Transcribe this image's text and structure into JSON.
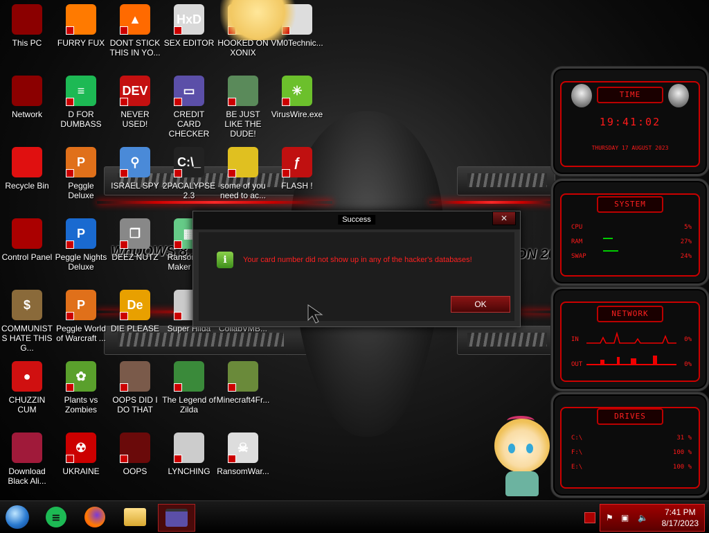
{
  "desktop_icons": [
    {
      "label": "This PC",
      "glyph": "",
      "color": "#8b0000",
      "icon": "computer-icon"
    },
    {
      "label": "FURRY FUX",
      "glyph": "",
      "color": "#ff7a00",
      "icon": "firefox-icon"
    },
    {
      "label": "DONT STICK THIS IN YO...",
      "glyph": "▲",
      "color": "#ff6a00",
      "icon": "vlc-cone-icon"
    },
    {
      "label": "SEX EDITOR",
      "glyph": "HxD",
      "color": "#d9d9d9",
      "icon": "hex-editor-icon"
    },
    {
      "label": "HOOKED ON XONIX",
      "glyph": "",
      "color": "#f3d18f",
      "icon": "cartoon-icon"
    },
    {
      "label": "VM0Technic...",
      "glyph": "",
      "color": "#ddd",
      "icon": "file-icon"
    },
    {
      "label": "Network",
      "glyph": "",
      "color": "#8b0000",
      "icon": "network-icon"
    },
    {
      "label": "D FOR DUMBASS",
      "glyph": "≡",
      "color": "#1db954",
      "icon": "spotify-icon"
    },
    {
      "label": "NEVER USED!",
      "glyph": "DEV",
      "color": "#c41010",
      "icon": "devcpp-icon"
    },
    {
      "label": "CREDIT CARD CHECKER",
      "glyph": "▭",
      "color": "#5b4fa8",
      "icon": "credit-card-icon"
    },
    {
      "label": "BE JUST LIKE THE DUDE!",
      "glyph": "",
      "color": "#5a8a5a",
      "icon": "elf-icon"
    },
    {
      "label": "VirusWire.exe",
      "glyph": "✳",
      "color": "#6cc02c",
      "icon": "limewire-icon"
    },
    {
      "label": "Recycle Bin",
      "glyph": "",
      "color": "#e01010",
      "icon": "recycle-bin-icon"
    },
    {
      "label": "Peggle Deluxe",
      "glyph": "P",
      "color": "#e0701a",
      "icon": "peggle-icon"
    },
    {
      "label": "ISRAEL SPY",
      "glyph": "⚲",
      "color": "#4a8ad8",
      "icon": "spy-icon"
    },
    {
      "label": "2PACALYPSE 2.3",
      "glyph": "C:\\_",
      "color": "#222",
      "icon": "terminal-icon"
    },
    {
      "label": "some of you need to ac...",
      "glyph": "",
      "color": "#e0c020",
      "icon": "dog-icon"
    },
    {
      "label": "FLASH !",
      "glyph": "ƒ",
      "color": "#c01010",
      "icon": "flash-icon"
    },
    {
      "label": "Control Panel",
      "glyph": "",
      "color": "#a00",
      "icon": "control-panel-icon"
    },
    {
      "label": "Peggle Nights Deluxe",
      "glyph": "P",
      "color": "#1a6ad0",
      "icon": "peggle-icon"
    },
    {
      "label": "DEEZ NUTZ",
      "glyph": "❐",
      "color": "#888",
      "icon": "windows-icon"
    },
    {
      "label": "Ransomw... Maker Bu...",
      "glyph": "▦",
      "color": "#6c8",
      "icon": "ransomware-icon"
    },
    {
      "label": "",
      "glyph": "",
      "color": "transparent",
      "icon": "hidden-icon"
    },
    {
      "label": "",
      "glyph": "",
      "color": "transparent",
      "icon": "hidden-icon"
    },
    {
      "label": "COMMUNISTS HATE THIS G...",
      "glyph": "$",
      "color": "#8a6a3a",
      "icon": "money-bag-icon"
    },
    {
      "label": "Peggle World of Warcraft ...",
      "glyph": "P",
      "color": "#e0701a",
      "icon": "peggle-icon"
    },
    {
      "label": "DIE PLEASE",
      "glyph": "De",
      "color": "#e8a000",
      "icon": "delphi-icon"
    },
    {
      "label": "Super Hilda",
      "glyph": "",
      "color": "#ccc",
      "icon": "game-icon"
    },
    {
      "label": "CollabVMB...",
      "glyph": "",
      "color": "transparent",
      "icon": "file-icon"
    },
    {
      "label": "",
      "glyph": "",
      "color": "transparent",
      "icon": "hidden-icon"
    },
    {
      "label": "CHUZZIN CUM",
      "glyph": "●",
      "color": "#d01010",
      "icon": "chuzzle-icon"
    },
    {
      "label": "Plants vs Zombies",
      "glyph": "✿",
      "color": "#5aa02c",
      "icon": "pvz-icon"
    },
    {
      "label": "OOPS DID I DO THAT",
      "glyph": "",
      "color": "#7a5a4a",
      "icon": "portrait-icon"
    },
    {
      "label": "The Legend of Zilda",
      "glyph": "",
      "color": "#3a8a3a",
      "icon": "zelda-icon"
    },
    {
      "label": "Minecraft4Fr...",
      "glyph": "",
      "color": "#6a8a3a",
      "icon": "minecraft-icon"
    },
    {
      "label": "",
      "glyph": "",
      "color": "transparent",
      "icon": "hidden-icon"
    },
    {
      "label": "Download Black Ali...",
      "glyph": "",
      "color": "#a01a3a",
      "icon": "alien-icon"
    },
    {
      "label": "UKRAINE",
      "glyph": "☢",
      "color": "#c00",
      "icon": "radiation-icon"
    },
    {
      "label": "OOPS",
      "glyph": "",
      "color": "#6a0a0a",
      "icon": "folder-icon"
    },
    {
      "label": "LYNCHING",
      "glyph": "",
      "color": "#ccc",
      "icon": "gear-icon"
    },
    {
      "label": "RansomWar...",
      "glyph": "☠",
      "color": "#ddd",
      "icon": "skull-icon"
    },
    {
      "label": "",
      "glyph": "",
      "color": "transparent",
      "icon": "hidden-icon"
    }
  ],
  "wallpaper_text": {
    "left": "WnDOWS 8.1",
    "right": "ON 20"
  },
  "widgets": {
    "time": {
      "title": "TIME",
      "clock": "19:41:02",
      "date": "THURSDAY 17 AUGUST 2023"
    },
    "system": {
      "title": "SYSTEM",
      "rows": [
        {
          "label": "CPU",
          "value": "5%"
        },
        {
          "label": "RAM",
          "value": "27%"
        },
        {
          "label": "SWAP",
          "value": "24%"
        }
      ]
    },
    "network": {
      "title": "NETWORK",
      "rows": [
        {
          "label": "IN",
          "value": "0%"
        },
        {
          "label": "OUT",
          "value": "0%"
        }
      ]
    },
    "drives": {
      "title": "DRIVES",
      "rows": [
        {
          "label": "C:\\",
          "value": "31 %"
        },
        {
          "label": "F:\\",
          "value": "100 %"
        },
        {
          "label": "E:\\",
          "value": "100 %"
        }
      ]
    }
  },
  "dialog": {
    "title": "Success",
    "message": "Your card number did not show up in any of the hacker's databases!",
    "ok": "OK",
    "close": "✕"
  },
  "taskbar": {
    "time": "7:41 PM",
    "date": "8/17/2023"
  },
  "colors": {
    "accent": "#ff1a1a",
    "tray": "#a00000"
  }
}
